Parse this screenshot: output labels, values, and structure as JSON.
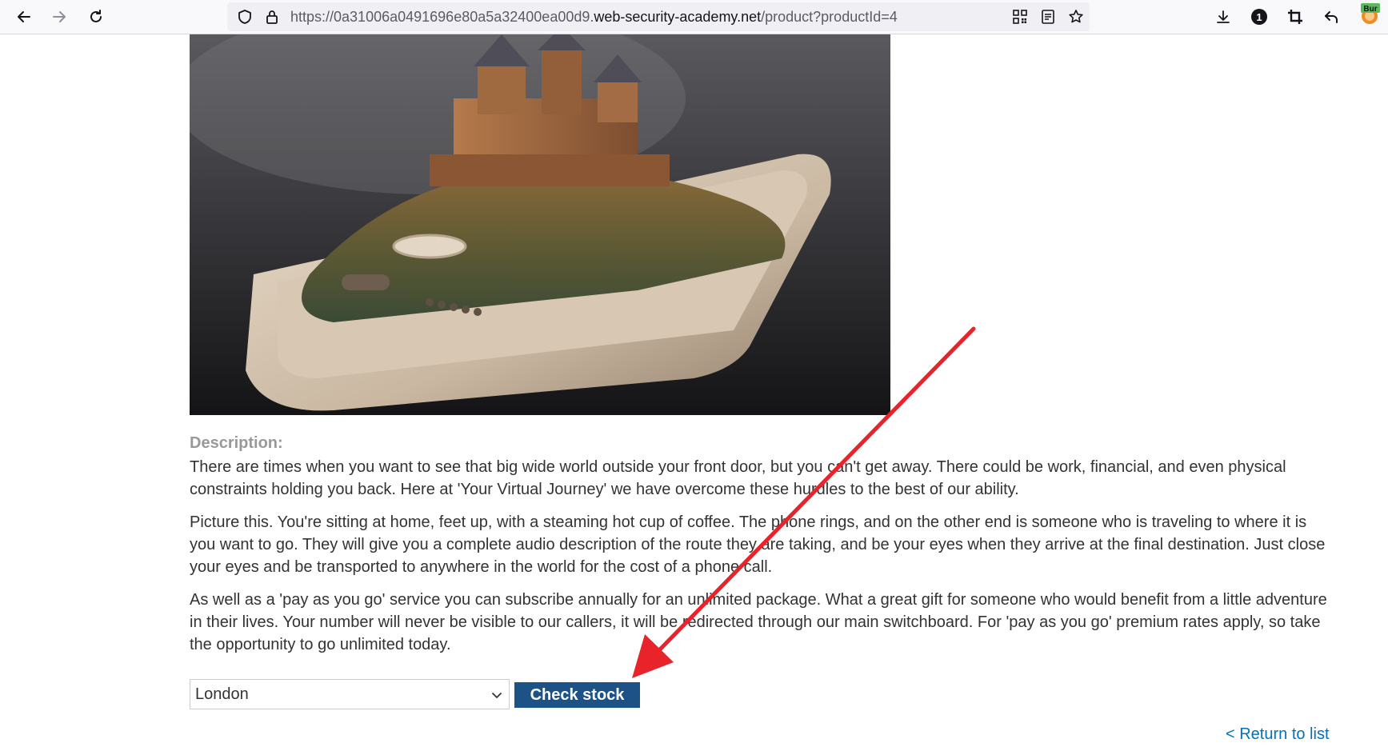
{
  "browser": {
    "url_prefix": "https://0a31006a0491696e80a5a32400ea00d9.",
    "url_host": "web-security-academy.net",
    "url_path": "/product?productId=4",
    "extension_label": "Bur"
  },
  "product": {
    "description_heading": "Description:",
    "paragraphs": [
      "There are times when you want to see that big wide world outside your front door, but you can't get away. There could be work, financial, and even physical constraints holding you back. Here at 'Your Virtual Journey' we have overcome these hurdles to the best of our ability.",
      "Picture this. You're sitting at home, feet up, with a steaming hot cup of coffee. The phone rings, and on the other end is someone who is traveling to where it is you want to go. They will give you a complete audio description of the route they are taking, and be your eyes when they arrive at the final destination. Just close your eyes and be transported to anywhere in the world for the cost of a phone call.",
      "As well as a 'pay as you go' service you can subscribe annually for an unlimited package. What a great gift for someone who would benefit from a little adventure in their lives. Your number will never be visible to our callers, it will be redirected through our main switchboard. For 'pay as you go' premium rates apply, so take the opportunity to go unlimited today."
    ]
  },
  "stock": {
    "selected_store": "London",
    "check_button": "Check stock"
  },
  "return_link": "< Return to list",
  "colors": {
    "button_bg": "#1c5286",
    "link": "#0071bc",
    "annotation_arrow": "#e8232a"
  },
  "icons": [
    "back-icon",
    "forward-icon",
    "reload-icon",
    "shield-icon",
    "lock-icon",
    "qr-code-icon",
    "reader-view-icon",
    "bookmark-star-icon",
    "download-icon",
    "extension-badge-icon",
    "crop-icon",
    "undo-icon",
    "burp-extension-icon",
    "chevron-down-icon"
  ]
}
